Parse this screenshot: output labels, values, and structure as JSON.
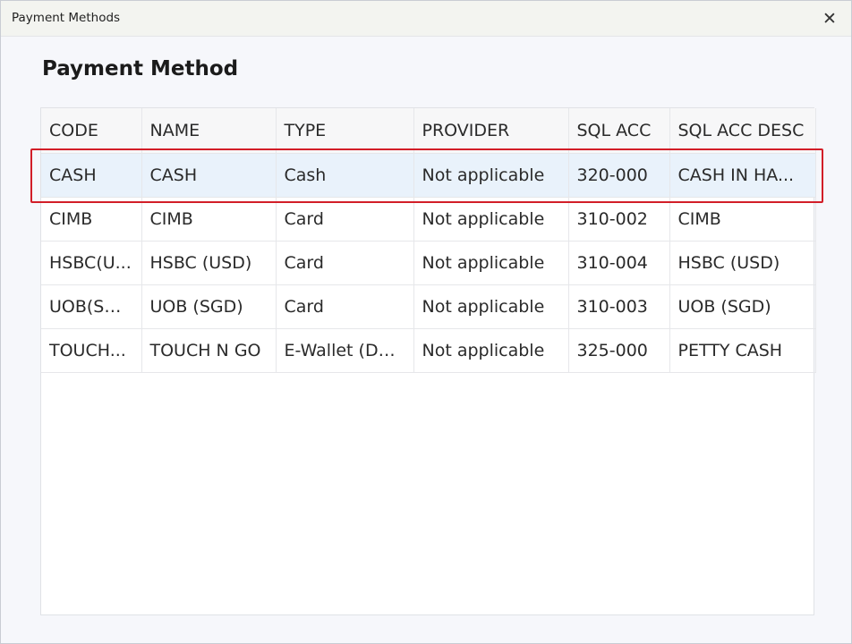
{
  "window": {
    "title": "Payment Methods",
    "close_glyph": "✕"
  },
  "heading": "Payment Method",
  "table": {
    "columns": [
      "CODE",
      "NAME",
      "TYPE",
      "PROVIDER",
      "SQL ACC",
      "SQL ACC DESC"
    ],
    "rows": [
      [
        "CASH",
        "CASH",
        "Cash",
        "Not applicable",
        "320-000",
        "CASH IN HA..."
      ],
      [
        "CIMB",
        "CIMB",
        "Card",
        "Not applicable",
        "310-002",
        "CIMB"
      ],
      [
        "HSBC(U...",
        "HSBC (USD)",
        "Card",
        "Not applicable",
        "310-004",
        "HSBC (USD)"
      ],
      [
        "UOB(SG...",
        "UOB (SGD)",
        "Card",
        "Not applicable",
        "310-003",
        "UOB (SGD)"
      ],
      [
        "TOUCH...",
        "TOUCH N GO",
        "E-Wallet (Du...",
        "Not applicable",
        "325-000",
        "PETTY CASH"
      ]
    ],
    "selected_row": 0
  },
  "colors": {
    "highlight_border": "#d21e28",
    "selected_row_bg": "#e9f2fb"
  }
}
